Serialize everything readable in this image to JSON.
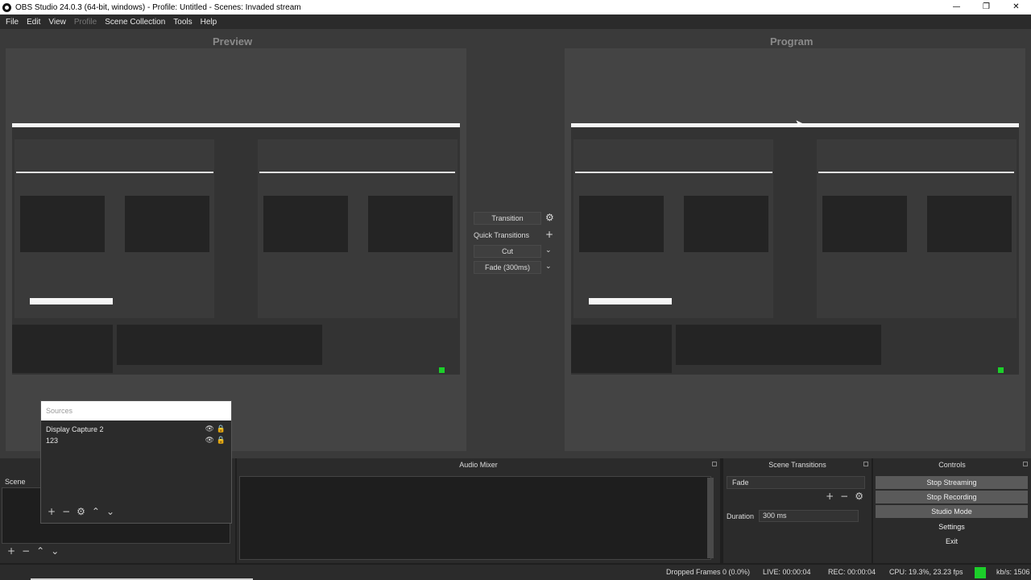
{
  "window": {
    "title": "OBS Studio 24.0.3 (64-bit, windows) - Profile: Untitled - Scenes: Invaded stream",
    "minimize": "—",
    "maximize": "❐",
    "close": "✕"
  },
  "menu": [
    "File",
    "Edit",
    "View",
    "Profile",
    "Scene Collection",
    "Tools",
    "Help"
  ],
  "panes": {
    "preview_label": "Preview",
    "program_label": "Program"
  },
  "transition": {
    "button": "Transition",
    "quick": "Quick Transitions",
    "cut": "Cut",
    "fade": "Fade (300ms)"
  },
  "sources": {
    "title": "Sources",
    "items": [
      {
        "name": "Display Capture 2"
      },
      {
        "name": "123"
      }
    ]
  },
  "scene": {
    "title": "Scene"
  },
  "audio_mixer": {
    "title": "Audio Mixer"
  },
  "scene_transitions": {
    "title": "Scene Transitions",
    "selected": "Fade",
    "duration_label": "Duration",
    "duration_value": "300 ms"
  },
  "controls": {
    "title": "Controls",
    "buttons": [
      "Stop Streaming",
      "Stop Recording",
      "Studio Mode",
      "Settings",
      "Exit"
    ]
  },
  "status": {
    "dropped": "Dropped Frames 0 (0.0%)",
    "live": "LIVE: 00:00:04",
    "rec": "REC: 00:00:04",
    "cpu": "CPU: 19.3%, 23.23 fps",
    "kbs": "kb/s: 1506"
  },
  "colors": {
    "status_green": "#1ccf2a",
    "background": "#3a3a3a"
  }
}
